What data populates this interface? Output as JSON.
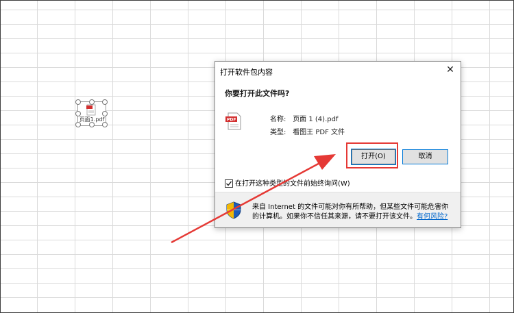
{
  "embedded_object": {
    "label": "页面1.pdf",
    "icon": "pdf-file-icon"
  },
  "dialog": {
    "title": "打开软件包内容",
    "question": "你要打开此文件吗?",
    "name_label": "名称:",
    "name_value": "页面 1 (4).pdf",
    "type_label": "类型:",
    "type_value": "看图王 PDF 文件",
    "open_button": "打开(O)",
    "cancel_button": "取消",
    "checkbox_label": "在打开这种类型的文件前始终询问(W)",
    "checkbox_checked": true,
    "warning_text": "来自 Internet 的文件可能对你有所帮助，但某些文件可能危害你的计算机。如果你不信任其来源，请不要打开该文件。",
    "help_link": "有何风险?"
  },
  "colors": {
    "highlight": "#e53935",
    "link": "#0066cc",
    "focus": "#0078d7"
  }
}
